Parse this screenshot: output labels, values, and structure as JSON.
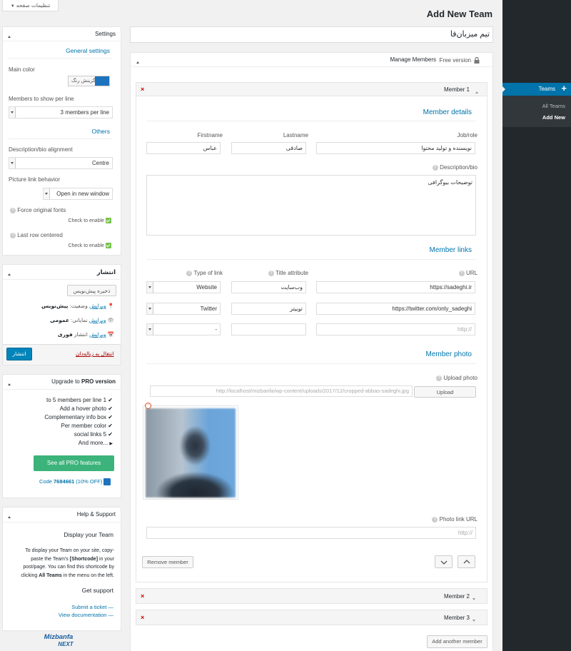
{
  "screen_options": "تنظیمات صفحه",
  "page_title": "Add New Team",
  "team_title": "تیم میزبان‌فا",
  "admin_menu": {
    "teams": "Teams",
    "all_teams": "All Teams",
    "add_new": "Add New"
  },
  "manage_members": {
    "title": "Manage Members",
    "free_version": "Free version"
  },
  "member1": {
    "header": "Member 1",
    "details_title": "Member details",
    "firstname_label": "Firstname",
    "firstname": "عباس",
    "lastname_label": "Lastname",
    "lastname": "صادقی",
    "job_label": "Job/role",
    "job": "نویسنده و تولید محتوا",
    "desc_label": "Description/bio",
    "desc": "توضیحات بیوگرافی",
    "links_title": "Member links",
    "type_label": "Type of link",
    "title_attr_label": "Title attribute",
    "url_label": "URL",
    "links": [
      {
        "type": "Website",
        "title": "وب‌سایت",
        "url": "https://sadeghi.ir"
      },
      {
        "type": "Twitter",
        "title": "توییتر",
        "url": "https://twitter.com/only_sadeghi"
      },
      {
        "type": "-",
        "title": "",
        "url": "http://"
      }
    ],
    "photo_title": "Member photo",
    "upload_label": "Upload photo",
    "photo_url": "http://localhost/mizbanfa/wp-content/uploads/2017/12/cropped-abbas-sadeghi.jpg",
    "upload_button": "Upload",
    "photo_link_label": "Photo link URL",
    "photo_link": "http://",
    "remove_button": "Remove member"
  },
  "member2": "Member 2",
  "member3": "Member 3",
  "add_member_button": "Add another member",
  "settings": {
    "title": "Settings",
    "general": "General settings",
    "main_color_label": "Main color",
    "color_button": "گزینش رنگ",
    "members_per_line_label": "Members to show per line",
    "members_per_line": "3 members per line",
    "others": "Others",
    "alignment_label": "Description/bio alignment",
    "alignment": "Centre",
    "picture_link_label": "Picture link behavior",
    "picture_link": "Open in new window",
    "force_fonts": "Force original fonts",
    "check_enable": "Check to enable",
    "last_row": "Last row centered",
    "check_enable2": "Check to enable"
  },
  "publish": {
    "title": "انتشار",
    "save_draft": "ذخیره پیش‌نویس",
    "status_label": "وضعیت:",
    "status_value": "پیش‌نویس",
    "status_edit": "ویرایش",
    "visibility_label": "نمایانی:",
    "visibility_value": "عمومی",
    "visibility_edit": "ویرایش",
    "publish_label": "انتشار",
    "publish_value": "فوری",
    "publish_edit": "ویرایش",
    "trash": "انتقال به زباله‌دان",
    "publish_button": "انتشار"
  },
  "upgrade": {
    "title_prefix": "Upgrade to ",
    "title_bold": "PRO version",
    "features": [
      "to 5 members per line 1",
      "Add a hover photo",
      "Complementary info box",
      "Per member color",
      "social links 5",
      "And more..."
    ],
    "button": "See all PRO features",
    "code_prefix": "Code ",
    "code_value": "7684661",
    "code_suffix": " (10% OFF)"
  },
  "help": {
    "title": "Help & Support",
    "display_title": "Display your Team",
    "text1": "To display your Team on your site, copy-",
    "text2a": "paste the Team's ",
    "text2b": "[Shortcode]",
    "text2c": " in your",
    "text3": "post/page. You can find this shortcode by",
    "text4a": "clicking ",
    "text4b": "All Teams",
    "text4c": " in the menu on the left.",
    "support_title": "Get support",
    "ticket": "Submit a ticket —",
    "docs": "View documentation —"
  },
  "logo": {
    "line1": "Mizbanfa",
    "line2": "NEXT"
  }
}
